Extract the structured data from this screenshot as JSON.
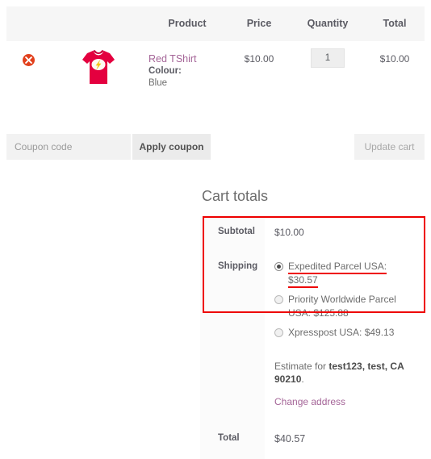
{
  "cart_table": {
    "headers": [
      "",
      "",
      "Product",
      "Price",
      "Quantity",
      "Total"
    ],
    "rows": [
      {
        "remove_icon": "remove-x-icon",
        "thumbnail": "red-tshirt-flash-logo-image",
        "product_name": "Red TShirt",
        "variation_label": "Colour:",
        "variation_value": "Blue",
        "price": "$10.00",
        "quantity": "1",
        "total": "$10.00"
      }
    ]
  },
  "actions": {
    "coupon_placeholder": "Coupon code",
    "coupon_value": "",
    "apply_coupon_label": "Apply coupon",
    "update_cart_label": "Update cart"
  },
  "cart_totals": {
    "title": "Cart totals",
    "subtotal_label": "Subtotal",
    "subtotal_value": "$10.00",
    "shipping_label": "Shipping",
    "shipping_options": [
      {
        "label": "Expedited Parcel USA: $30.57",
        "selected": true
      },
      {
        "label": "Priority Worldwide Parcel USA: $125.88",
        "selected": false
      },
      {
        "label": "Xpresspost USA: $49.13",
        "selected": false
      }
    ],
    "estimate_prefix": "Estimate for ",
    "estimate_address": "test123, test, CA 90210",
    "estimate_suffix": ".",
    "change_address_label": "Change address",
    "total_label": "Total",
    "total_value": "$40.57"
  },
  "colors": {
    "link": "#a46497",
    "remove_badge": "#e2401c",
    "highlight_box": "#ee0000",
    "header_bg": "#f6f6f6",
    "text": "#5b5b63"
  }
}
